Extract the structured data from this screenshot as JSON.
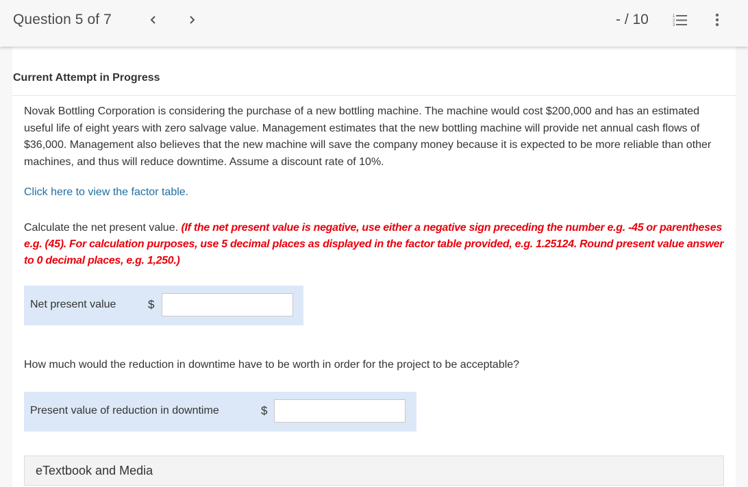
{
  "header": {
    "question_title": "Question 5 of 7",
    "prev_glyph": "‹",
    "next_glyph": "›",
    "score": "- / 10",
    "icons": [
      "numbered-list-icon",
      "more-vertical-icon"
    ]
  },
  "main": {
    "attempt_heading": "Current Attempt in Progress",
    "problem_text": "Novak Bottling Corporation is considering the purchase of a new bottling machine. The machine would cost $200,000 and has an estimated useful life of eight years with zero salvage value. Management estimates that the new bottling machine will provide net annual cash flows of $36,000. Management also believes that the new machine will save the company money because it is expected to be more reliable than other machines, and thus will reduce downtime. Assume a discount rate of 10%.",
    "factor_link": "Click here to view the factor table.",
    "instruction_plain": "Calculate the net present value. ",
    "instruction_red": "(If the net present value is negative, use either a negative sign preceding the number e.g. -45 or parentheses e.g. (45). For calculation purposes, use 5 decimal places as displayed in the factor table provided, e.g. 1.25124. Round present value answer to 0 decimal places, e.g. 1,250.)",
    "answer1": {
      "label": "Net present value",
      "currency": "$",
      "value": ""
    },
    "question2": "How much would the reduction in downtime have to be worth in order for the project to be acceptable?",
    "answer2": {
      "label": "Present value of reduction in downtime",
      "currency": "$",
      "value": ""
    },
    "etextbook_label": "eTextbook and Media"
  },
  "colors": {
    "link": "#1f6fa3",
    "instruction_red": "#e8000b",
    "answer_box_bg": "#dce8f7",
    "page_bg": "#f7f7f7"
  }
}
